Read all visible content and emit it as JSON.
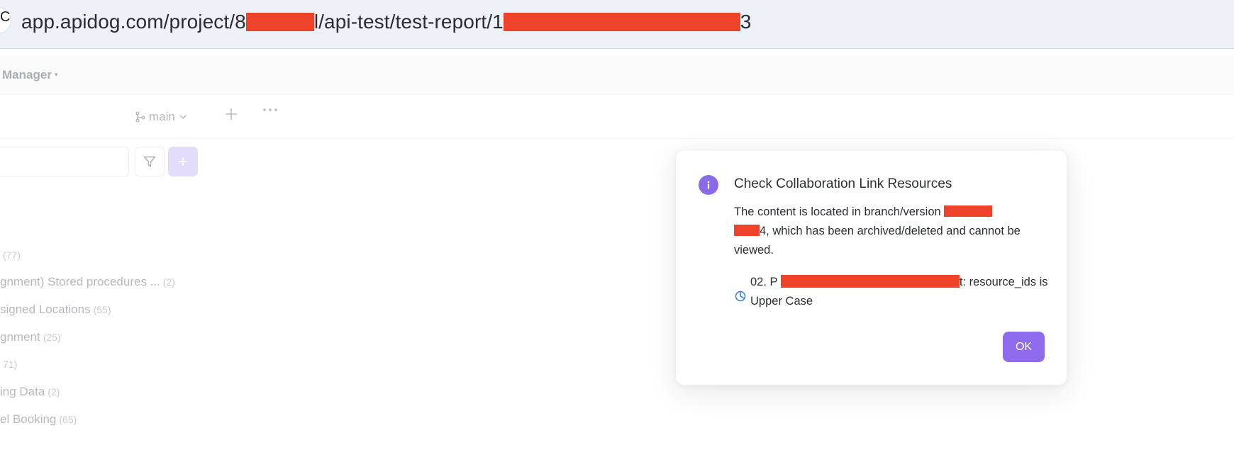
{
  "browser": {
    "url_parts": [
      "app.apidog.com/project/",
      "8",
      "l/api-test/test-report/1",
      "3"
    ],
    "side_glyph": "C"
  },
  "header": {
    "menu_label": "Manager",
    "menu_caret": "▾"
  },
  "toolbar": {
    "branch_label": "main"
  },
  "tree": {
    "items": [
      {
        "label": "",
        "count": "(77)"
      },
      {
        "label": "gnment) Stored procedures ...",
        "count": "(2)"
      },
      {
        "label": "signed Locations",
        "count": "(55)"
      },
      {
        "label": "gnment",
        "count": "(25)"
      },
      {
        "label": "",
        "count": "71)"
      },
      {
        "label": "ing Data",
        "count": "(2)"
      },
      {
        "label": "el Booking",
        "count": "(65)"
      }
    ]
  },
  "modal": {
    "title": "Check Collaboration Link Resources",
    "body_part1": "The content is located in branch/version ",
    "body_part2": "4, which has been archived/deleted and cannot be viewed.",
    "resource_prefix": "02. P ",
    "resource_suffix": "t: resource_ids is Upper Case",
    "ok_label": "OK"
  },
  "colors": {
    "accent": "#8e6ced",
    "info_icon": "#8a6ae6",
    "redaction": "#ee4229",
    "resource_icon": "#2f7fe0"
  }
}
